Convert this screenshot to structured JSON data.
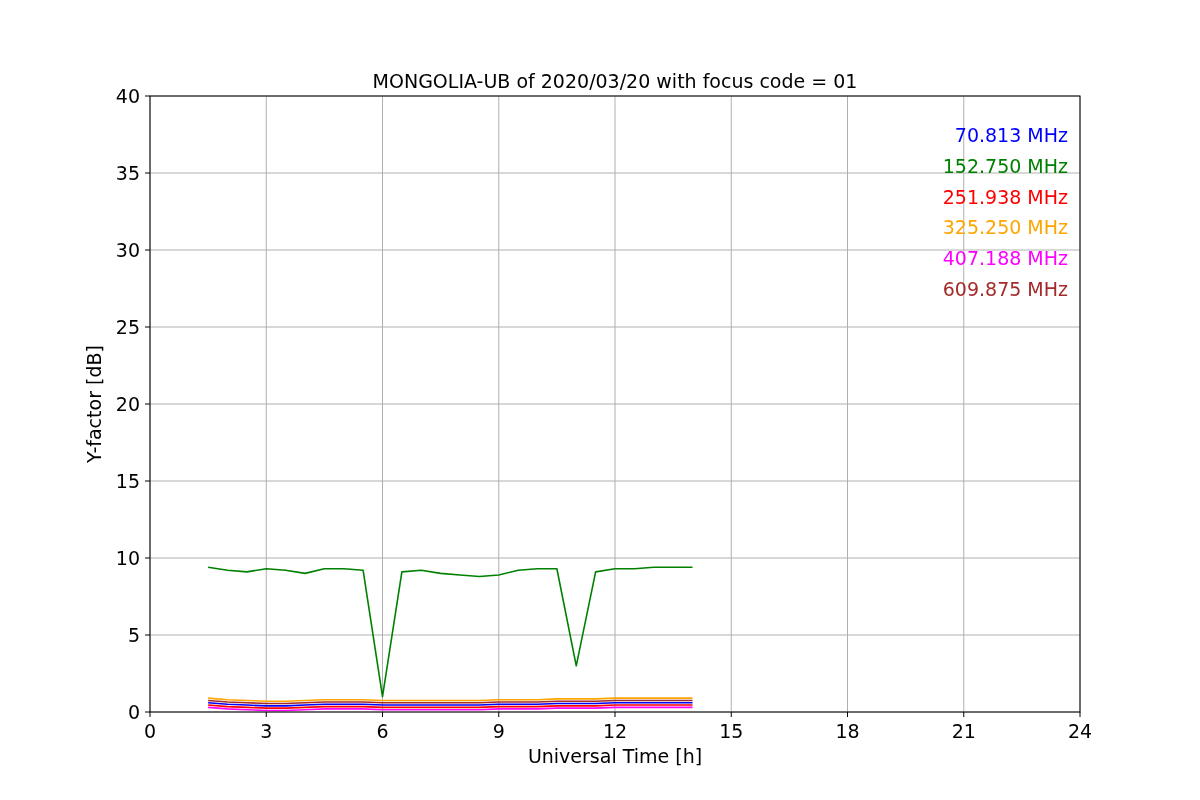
{
  "chart_data": {
    "type": "line",
    "title": "MONGOLIA-UB of 2020/03/20 with focus code = 01",
    "xlabel": "Universal Time [h]",
    "ylabel": "Y-factor [dB]",
    "xlim": [
      0,
      24
    ],
    "ylim": [
      0,
      40
    ],
    "xticks": [
      0,
      3,
      6,
      9,
      12,
      15,
      18,
      21,
      24
    ],
    "yticks": [
      0,
      5,
      10,
      15,
      20,
      25,
      30,
      35,
      40
    ],
    "grid": true,
    "x": [
      1.5,
      2,
      2.5,
      3,
      3.5,
      4,
      4.5,
      5,
      5.5,
      6,
      6.5,
      7,
      7.5,
      8,
      8.5,
      9,
      9.5,
      10,
      10.5,
      11,
      11.5,
      12,
      12.5,
      13,
      13.5,
      14
    ],
    "series": [
      {
        "name": "70.813 MHz",
        "color": "#0000ff",
        "values": [
          0.6,
          0.5,
          0.45,
          0.4,
          0.4,
          0.45,
          0.5,
          0.5,
          0.5,
          0.45,
          0.45,
          0.45,
          0.45,
          0.45,
          0.45,
          0.5,
          0.5,
          0.5,
          0.55,
          0.55,
          0.55,
          0.6,
          0.6,
          0.6,
          0.6,
          0.6
        ]
      },
      {
        "name": "152.750 MHz",
        "color": "#008000",
        "values": [
          9.4,
          9.2,
          9.1,
          9.3,
          9.2,
          9.0,
          9.3,
          9.3,
          9.2,
          1.0,
          9.1,
          9.2,
          9.0,
          8.9,
          8.8,
          8.9,
          9.2,
          9.3,
          9.3,
          3.0,
          9.1,
          9.3,
          9.3,
          9.4,
          9.4,
          9.4
        ]
      },
      {
        "name": "251.938 MHz",
        "color": "#ff0000",
        "values": [
          0.45,
          0.35,
          0.3,
          0.25,
          0.25,
          0.3,
          0.35,
          0.35,
          0.35,
          0.3,
          0.3,
          0.3,
          0.3,
          0.3,
          0.3,
          0.35,
          0.35,
          0.35,
          0.4,
          0.4,
          0.4,
          0.45,
          0.45,
          0.45,
          0.45,
          0.45
        ]
      },
      {
        "name": "325.250 MHz",
        "color": "#ffa500",
        "values": [
          0.9,
          0.8,
          0.75,
          0.7,
          0.7,
          0.75,
          0.8,
          0.8,
          0.8,
          0.75,
          0.75,
          0.75,
          0.75,
          0.75,
          0.75,
          0.8,
          0.8,
          0.8,
          0.85,
          0.85,
          0.85,
          0.9,
          0.9,
          0.9,
          0.9,
          0.9
        ]
      },
      {
        "name": "407.188 MHz",
        "color": "#ff00ff",
        "values": [
          0.3,
          0.2,
          0.15,
          0.1,
          0.1,
          0.15,
          0.2,
          0.2,
          0.2,
          0.15,
          0.15,
          0.15,
          0.15,
          0.15,
          0.15,
          0.2,
          0.2,
          0.2,
          0.25,
          0.25,
          0.25,
          0.3,
          0.3,
          0.3,
          0.3,
          0.3
        ]
      },
      {
        "name": "609.875 MHz",
        "color": "#a52a2a",
        "values": [
          0.75,
          0.65,
          0.6,
          0.55,
          0.55,
          0.6,
          0.65,
          0.65,
          0.65,
          0.6,
          0.6,
          0.6,
          0.6,
          0.6,
          0.6,
          0.65,
          0.65,
          0.65,
          0.7,
          0.7,
          0.7,
          0.75,
          0.75,
          0.75,
          0.75,
          0.75
        ]
      }
    ]
  }
}
